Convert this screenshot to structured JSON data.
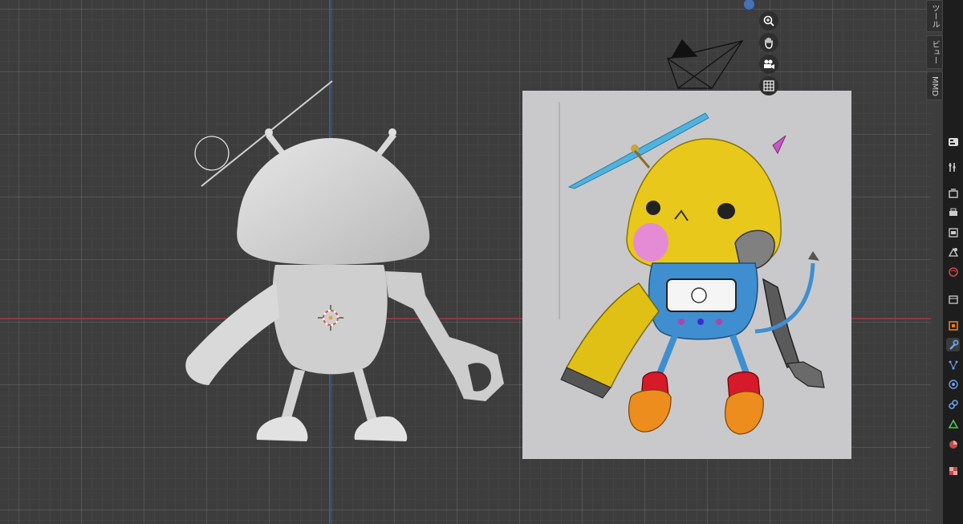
{
  "viewport": {
    "navigation_buttons": [
      {
        "name": "zoom-icon"
      },
      {
        "name": "hand-pan-icon"
      },
      {
        "name": "camera-view-icon"
      },
      {
        "name": "grid-ortho-icon"
      }
    ]
  },
  "sidebar": {
    "tabs": [
      {
        "label": "ツール"
      },
      {
        "label": "ビュー"
      },
      {
        "label": "MMD"
      }
    ]
  },
  "properties_panel": {
    "icons": [
      "tool-settings-icon",
      "render-icon",
      "output-icon",
      "view-layer-icon",
      "scene-icon",
      "world-icon",
      "collection-icon",
      "object-icon",
      "modifier-wrench-icon",
      "particles-icon",
      "physics-icon",
      "constraints-icon",
      "data-icon",
      "material-icon",
      "texture-icon"
    ],
    "active": "modifier-wrench-icon"
  },
  "colors": {
    "grid_background": "#3d3d3d",
    "x_axis": "#8a3a46",
    "y_axis": "#3b5a93",
    "reference_background": "#c9c9cb"
  }
}
